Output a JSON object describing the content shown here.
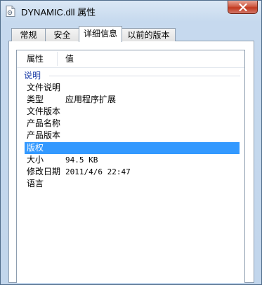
{
  "window": {
    "title": "DYNAMIC.dll 属性"
  },
  "tabs": [
    {
      "label": "常规",
      "active": false
    },
    {
      "label": "安全",
      "active": false
    },
    {
      "label": "详细信息",
      "active": true
    },
    {
      "label": "以前的版本",
      "active": false
    }
  ],
  "list": {
    "columns": {
      "property": "属性",
      "value": "值"
    },
    "group": "说明",
    "rows": [
      {
        "key": "文件说明",
        "value": ""
      },
      {
        "key": "类型",
        "value": "应用程序扩展"
      },
      {
        "key": "文件版本",
        "value": ""
      },
      {
        "key": "产品名称",
        "value": ""
      },
      {
        "key": "产品版本",
        "value": ""
      },
      {
        "key": "版权",
        "value": "",
        "selected": true
      },
      {
        "key": "大小",
        "value": "94.5 KB"
      },
      {
        "key": "修改日期",
        "value": "2011/4/6 22:47"
      },
      {
        "key": "语言",
        "value": ""
      }
    ]
  },
  "colors": {
    "selection": "#3399ff",
    "group_text": "#1e3fa8",
    "close_button": "#c2391f"
  },
  "icons": {
    "title": "file-icon",
    "close": "close-icon"
  }
}
